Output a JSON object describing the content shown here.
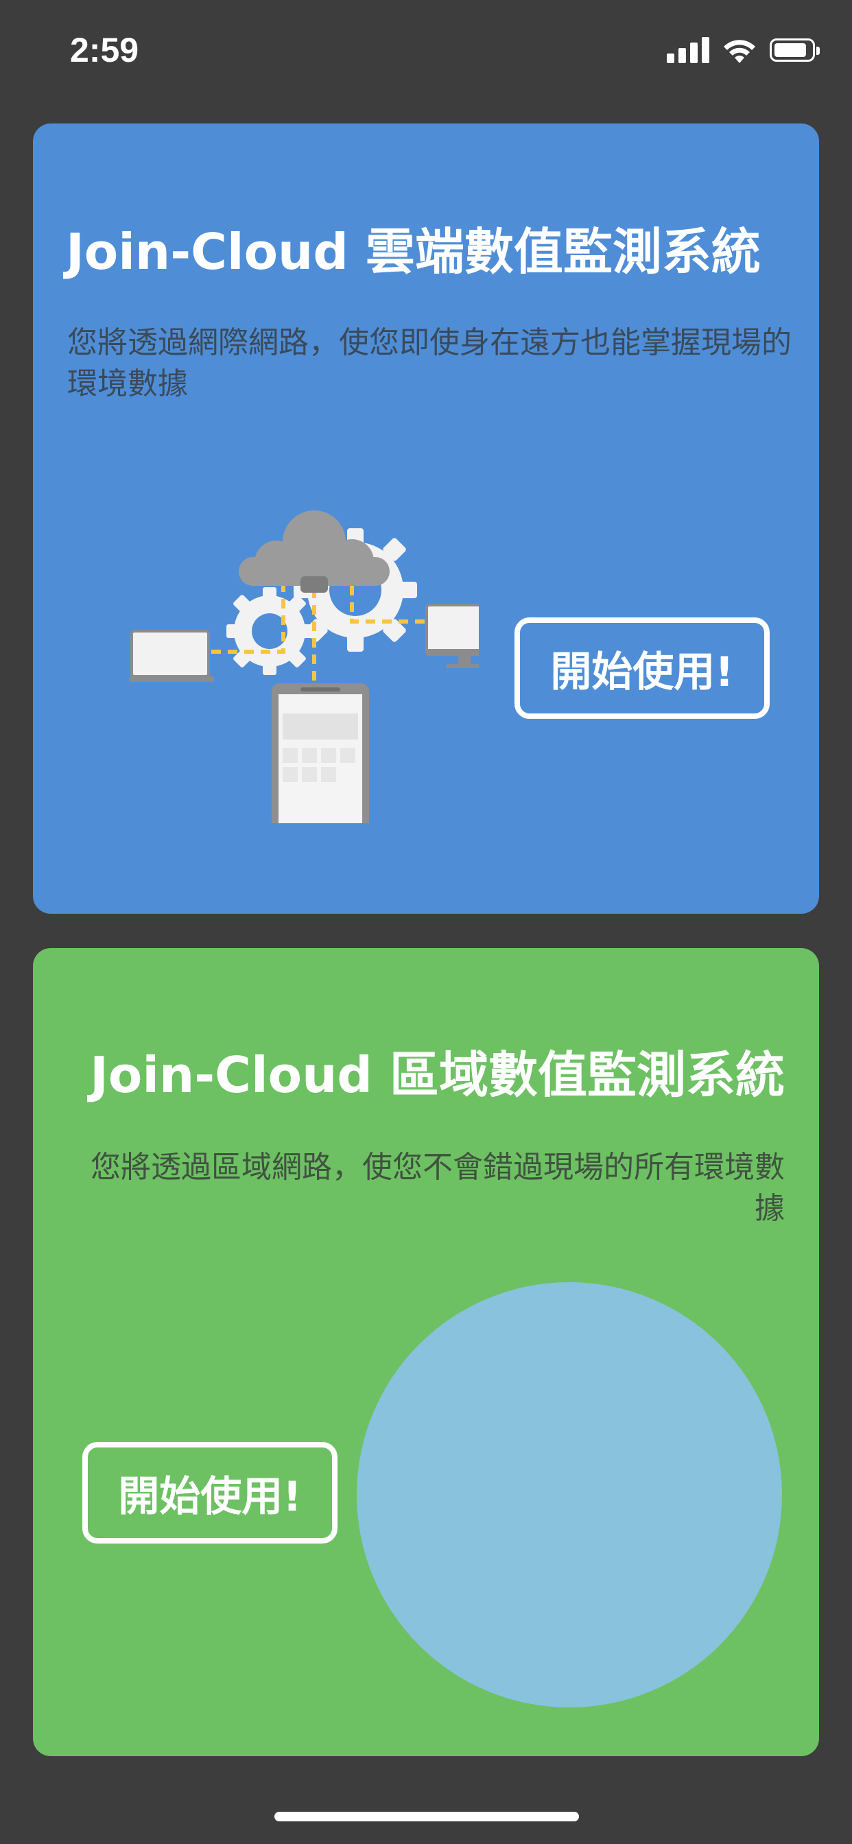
{
  "status_bar": {
    "time": "2:59"
  },
  "cards": {
    "cloud": {
      "title": "Join-Cloud 雲端數值監測系統",
      "description": "您將透過網際網路，使您即使身在遠方也能掌握現場的環境數據",
      "button_label": "開始使用!",
      "background": "#4f8ed7"
    },
    "local": {
      "title": "Join-Cloud 區域數值監測系統",
      "description": "您將透過區域網路，使您不會錯過現場的所有環境數據",
      "button_label": "開始使用!",
      "background": "#6dc163"
    }
  },
  "colors": {
    "screen_background": "#3d3d3d",
    "illustration_circle": "#88c2dc",
    "connection_line": "#f5c542"
  },
  "icons": {
    "status": [
      "cellular-signal-icon",
      "wifi-icon",
      "battery-icon"
    ],
    "illustration": [
      "laptop-icon",
      "cloud-icon",
      "gear-icon",
      "monitor-icon",
      "smartphone-icon"
    ]
  }
}
